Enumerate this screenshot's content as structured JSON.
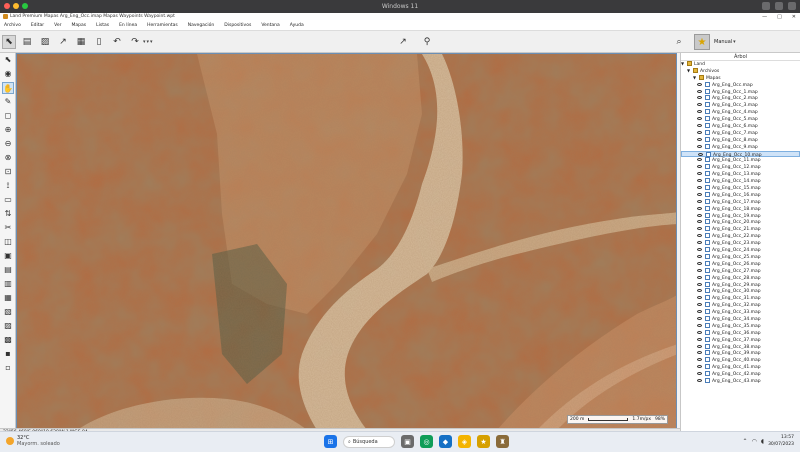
{
  "vm": {
    "title": "Windows 11",
    "dot_colors": [
      "#ff5f57",
      "#febc2e",
      "#28c840"
    ]
  },
  "app": {
    "title": "Land Premium Mapas Arg_Eng_Occ.imap Mapas Waypoints Waypoint.wpt",
    "min": "—",
    "max": "□",
    "close": "✕"
  },
  "menu": [
    "Archivo",
    "Editar",
    "Ver",
    "Mapas",
    "Listas",
    "En línea",
    "Herramientas",
    "Navegación",
    "Dispositivos",
    "Ventana",
    "Ayuda"
  ],
  "toolbar": {
    "icons": [
      "cursor-icon",
      "clipboard-icon",
      "image-icon",
      "route-icon",
      "map-icon",
      "battery-icon",
      "undo-icon",
      "redo-icon"
    ],
    "glyphs": [
      "⬉",
      "▤",
      "▨",
      "↗",
      "▦",
      "▯",
      "↶",
      "↷"
    ],
    "mode_label": "Manual",
    "star": "★",
    "search": "⌕",
    "caret": "▾",
    "nav_glyph": "↗",
    "gps_glyph": "⚲"
  },
  "left_tools": [
    "⬉",
    "◉",
    "✋",
    "✎",
    "◻",
    "⊕",
    "⊖",
    "⊗",
    "⊡",
    "⟟",
    "▭",
    "⇅",
    "✂",
    "◫",
    "▣",
    "▤",
    "▥",
    "▦",
    "▧",
    "▨",
    "▩",
    "▪",
    "▫"
  ],
  "tree": {
    "header": "Árbol",
    "root": "Land",
    "archivos": "Archivos",
    "mapas": "Mapas",
    "items": [
      "Arg_Eng_Occ.map",
      "Arg_Eng_Occ_1.map",
      "Arg_Eng_Occ_2.map",
      "Arg_Eng_Occ_3.map",
      "Arg_Eng_Occ_4.map",
      "Arg_Eng_Occ_5.map",
      "Arg_Eng_Occ_6.map",
      "Arg_Eng_Occ_7.map",
      "Arg_Eng_Occ_8.map",
      "Arg_Eng_Occ_9.map",
      "Arg_Eng_Occ_10.map",
      "Arg_Eng_Occ_11.map",
      "Arg_Eng_Occ_12.map",
      "Arg_Eng_Occ_13.map",
      "Arg_Eng_Occ_14.map",
      "Arg_Eng_Occ_15.map",
      "Arg_Eng_Occ_16.map",
      "Arg_Eng_Occ_17.map",
      "Arg_Eng_Occ_18.map",
      "Arg_Eng_Occ_19.map",
      "Arg_Eng_Occ_20.map",
      "Arg_Eng_Occ_21.map",
      "Arg_Eng_Occ_22.map",
      "Arg_Eng_Occ_23.map",
      "Arg_Eng_Occ_24.map",
      "Arg_Eng_Occ_25.map",
      "Arg_Eng_Occ_26.map",
      "Arg_Eng_Occ_27.map",
      "Arg_Eng_Occ_28.map",
      "Arg_Eng_Occ_29.map",
      "Arg_Eng_Occ_30.map",
      "Arg_Eng_Occ_31.map",
      "Arg_Eng_Occ_32.map",
      "Arg_Eng_Occ_33.map",
      "Arg_Eng_Occ_34.map",
      "Arg_Eng_Occ_35.map",
      "Arg_Eng_Occ_36.map",
      "Arg_Eng_Occ_37.map",
      "Arg_Eng_Occ_38.map",
      "Arg_Eng_Occ_39.map",
      "Arg_Eng_Occ_40.map",
      "Arg_Eng_Occ_41.map",
      "Arg_Eng_Occ_42.map",
      "Arg_Eng_Occ_43.map"
    ],
    "selected_index": 10
  },
  "map": {
    "scale_label": "200 m",
    "zoom": "98%",
    "speed": "1.7m/px"
  },
  "status": {
    "coords": "22°56.468'S 069°19.628'W  ?  WGS 84"
  },
  "taskbar": {
    "temp": "32°C",
    "weather": "Mayorm. soleado",
    "search": "Búsqueda",
    "time": "13:57",
    "date": "30/07/2023",
    "icons": [
      "⊞",
      "▣",
      "◎",
      "◆",
      "◈",
      "★",
      "♜"
    ],
    "icon_colors": [
      "#1a73e8",
      "#6b6b6b",
      "#0f9d58",
      "#1570c5",
      "#f4b400",
      "#d6a000",
      "#8a6b3a"
    ]
  }
}
